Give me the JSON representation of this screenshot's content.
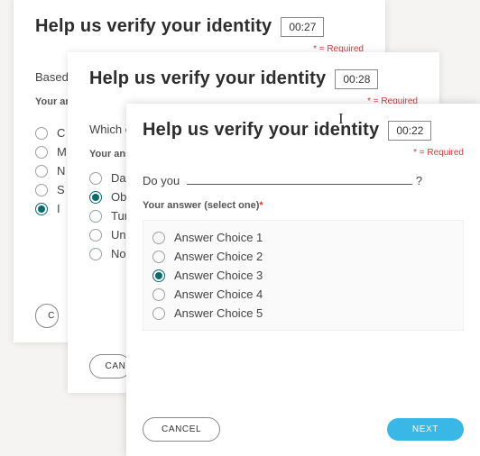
{
  "required_label": "* = Required",
  "asterisk": "*",
  "card1": {
    "title": "Help us verify your identity",
    "timer": "00:27",
    "question_prefix": "Based ",
    "instruction": "Your an",
    "options": [
      "C",
      "M",
      "N",
      "S",
      "I"
    ],
    "selected": 4,
    "cancel": "C"
  },
  "card2": {
    "title": "Help us verify your identity",
    "timer": "00:28",
    "question_prefix": "Which of",
    "instruction": "Your ans",
    "options": [
      "Dar",
      "Ob",
      "Tur",
      "Uni",
      "Nor"
    ],
    "selected": 1,
    "cancel": "CAN"
  },
  "card3": {
    "title": "Help us verify your identity",
    "timer": "00:22",
    "question_prefix": "Do you ",
    "question_suffix": "?",
    "instruction": "Your answer (select one)",
    "options": [
      "Answer Choice 1",
      "Answer Choice 2",
      "Answer Choice 3",
      "Answer Choice 4",
      "Answer Choice 5"
    ],
    "selected": 2,
    "cancel": "CANCEL",
    "next": "NEXT"
  }
}
